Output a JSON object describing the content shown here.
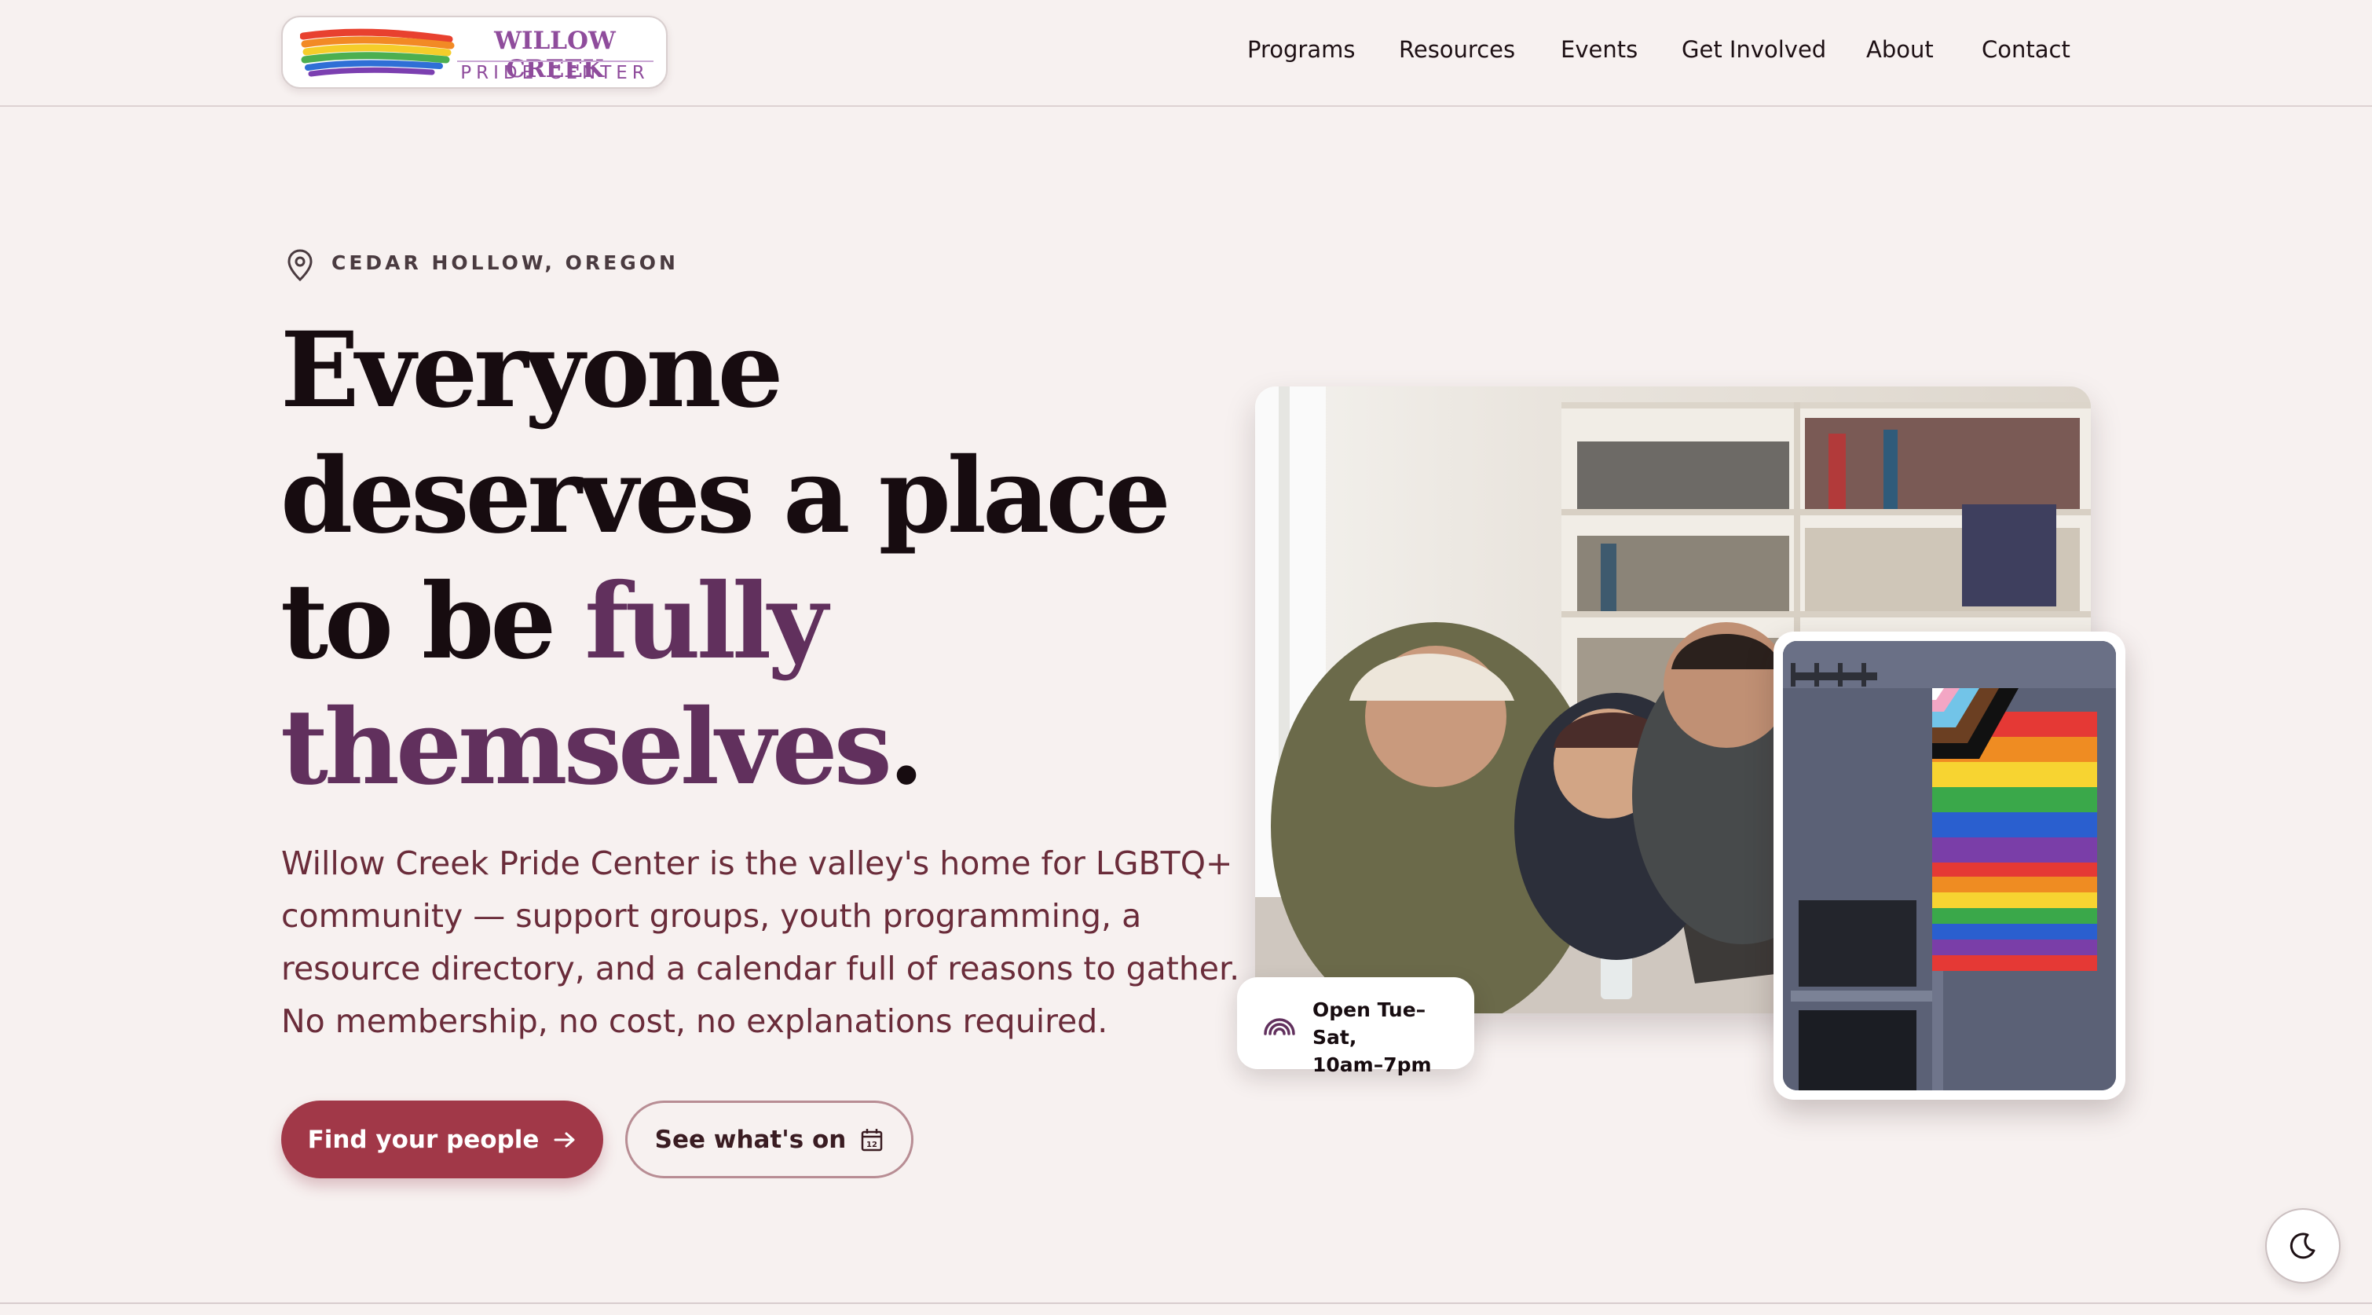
{
  "logo": {
    "name_top": "WILLOW CREEK",
    "name_bottom": "PRIDE CENTER",
    "mark_icon": "rainbow-brushstroke-logo"
  },
  "nav": {
    "items": [
      {
        "label": "Programs"
      },
      {
        "label": "Resources"
      },
      {
        "label": "Events"
      },
      {
        "label": "Get Involved"
      },
      {
        "label": "About"
      },
      {
        "label": "Contact"
      }
    ]
  },
  "hero": {
    "location_icon": "map-pin-icon",
    "location": "CEDAR HOLLOW, OREGON",
    "headline": {
      "line1": "Everyone",
      "line2": "deserves a place",
      "line3_plain": "to be ",
      "line3_accent": "fully",
      "line4_accent": "themselves",
      "line4_period": "."
    },
    "lede": "Willow Creek Pride Center is the valley's home for LGBTQ+ community — support groups, youth programming, a resource directory, and a calendar full of reasons to gather. No membership, no cost, no explanations required.",
    "primary_button": {
      "label": "Find your people",
      "icon": "arrow-right-icon"
    },
    "secondary_button": {
      "label": "See what's on",
      "icon": "calendar-icon"
    }
  },
  "media": {
    "main_photo_alt": "group-of-friends-laughing-in-library-photo",
    "flag_photo_alt": "progress-pride-flag-on-building-photo",
    "hours_icon": "rainbow-icon",
    "hours_line1": "Open Tue–Sat,",
    "hours_line2": "10am–7pm"
  },
  "theme_toggle": {
    "icon": "moon-icon"
  },
  "colors": {
    "background": "#f7f1f0",
    "accent_purple": "#61305d",
    "primary_button": "#a13848",
    "lede_text": "#6a2c3a",
    "logo_purple": "#8f4c9c"
  }
}
